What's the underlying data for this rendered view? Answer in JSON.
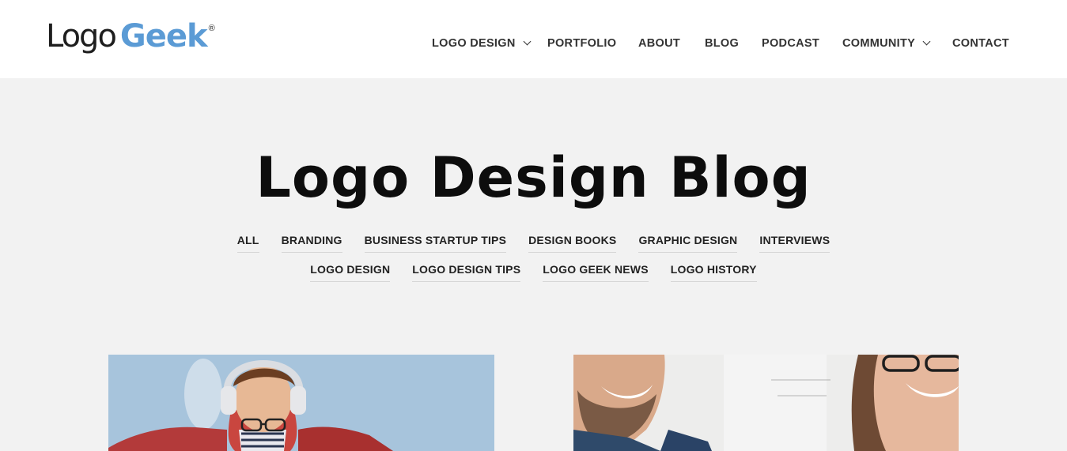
{
  "brand": {
    "logo_part1": "Logo",
    "logo_part2": "Geek",
    "registered": "®",
    "accent_color": "#5b9bd5"
  },
  "nav": {
    "items": [
      {
        "label": "LOGO DESIGN",
        "has_dropdown": true
      },
      {
        "label": "PORTFOLIO",
        "has_dropdown": false
      },
      {
        "label": "ABOUT",
        "has_dropdown": false
      },
      {
        "label": "BLOG",
        "has_dropdown": false
      },
      {
        "label": "PODCAST",
        "has_dropdown": false
      },
      {
        "label": "COMMUNITY",
        "has_dropdown": true
      },
      {
        "label": "CONTACT",
        "has_dropdown": false
      }
    ]
  },
  "hero": {
    "title": "Logo Design Blog"
  },
  "categories": {
    "row1": [
      "ALL",
      "BRANDING",
      "BUSINESS STARTUP TIPS",
      "DESIGN BOOKS",
      "GRAPHIC DESIGN",
      "INTERVIEWS"
    ],
    "row2": [
      "LOGO DESIGN",
      "LOGO DESIGN TIPS",
      "LOGO GEEK NEWS",
      "LOGO HISTORY"
    ]
  },
  "posts": [
    {
      "image": "man-with-headphones-photo"
    },
    {
      "image": "smiling-man-and-woman-photo"
    }
  ]
}
